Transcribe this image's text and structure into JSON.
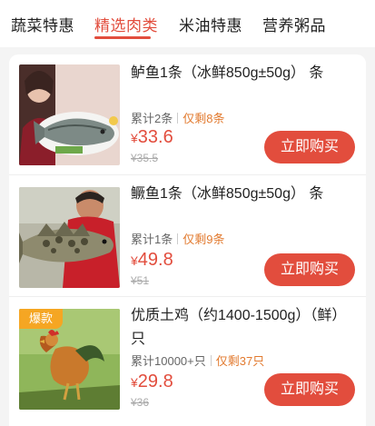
{
  "tabs": [
    {
      "label": "蔬菜特惠",
      "active": false
    },
    {
      "label": "精选肉类",
      "active": true
    },
    {
      "label": "米油特惠",
      "active": false
    },
    {
      "label": "营养粥品",
      "active": false
    }
  ],
  "colors": {
    "accent": "#e24d3d",
    "remain": "#e27a2f",
    "badge": "#f5a623"
  },
  "products": [
    {
      "name": "鲈鱼1条（冰鲜850g±50g） 条",
      "sold": "累计2条",
      "remain": "仅剩8条",
      "currency": "¥",
      "price": "33.6",
      "original": "¥35.5",
      "button": "立即购买",
      "badge": ""
    },
    {
      "name": "鳜鱼1条（冰鲜850g±50g） 条",
      "sold": "累计1条",
      "remain": "仅剩9条",
      "currency": "¥",
      "price": "49.8",
      "original": "¥51",
      "button": "立即购买",
      "badge": ""
    },
    {
      "name": "优质土鸡（约1400-1500g）（鲜） 只",
      "sold": "累计10000+只",
      "remain": "仅剩37只",
      "currency": "¥",
      "price": "29.8",
      "original": "¥36",
      "button": "立即购买",
      "badge": "爆款"
    }
  ]
}
